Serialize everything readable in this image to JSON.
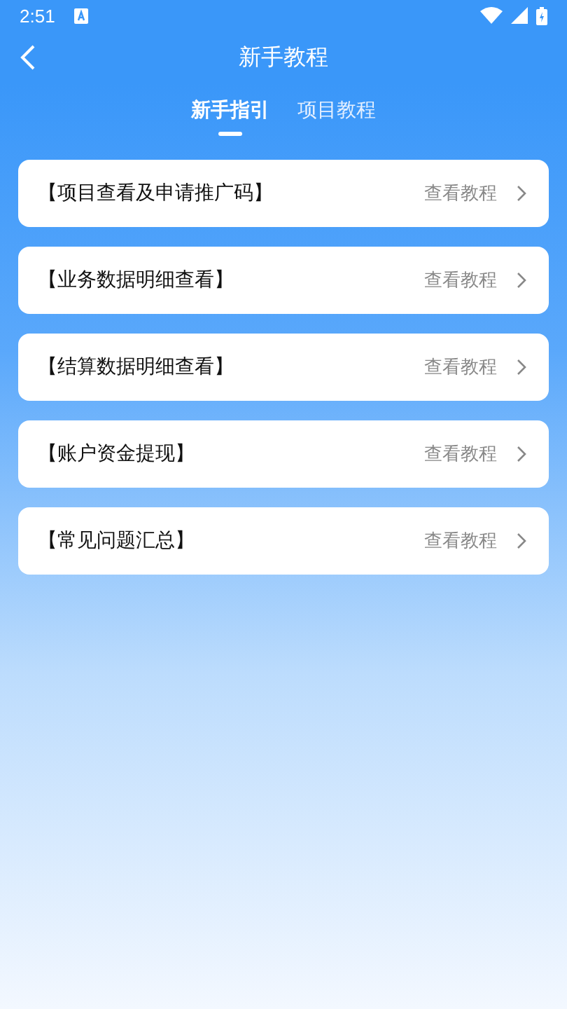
{
  "status_bar": {
    "time": "2:51"
  },
  "header": {
    "title": "新手教程"
  },
  "tabs": [
    {
      "label": "新手指引",
      "selected": true
    },
    {
      "label": "项目教程",
      "selected": false
    }
  ],
  "items": [
    {
      "title": "【项目查看及申请推广码】",
      "action": "查看教程"
    },
    {
      "title": "【业务数据明细查看】",
      "action": "查看教程"
    },
    {
      "title": "【结算数据明细查看】",
      "action": "查看教程"
    },
    {
      "title": "【账户资金提现】",
      "action": "查看教程"
    },
    {
      "title": "【常见问题汇总】",
      "action": "查看教程"
    }
  ]
}
